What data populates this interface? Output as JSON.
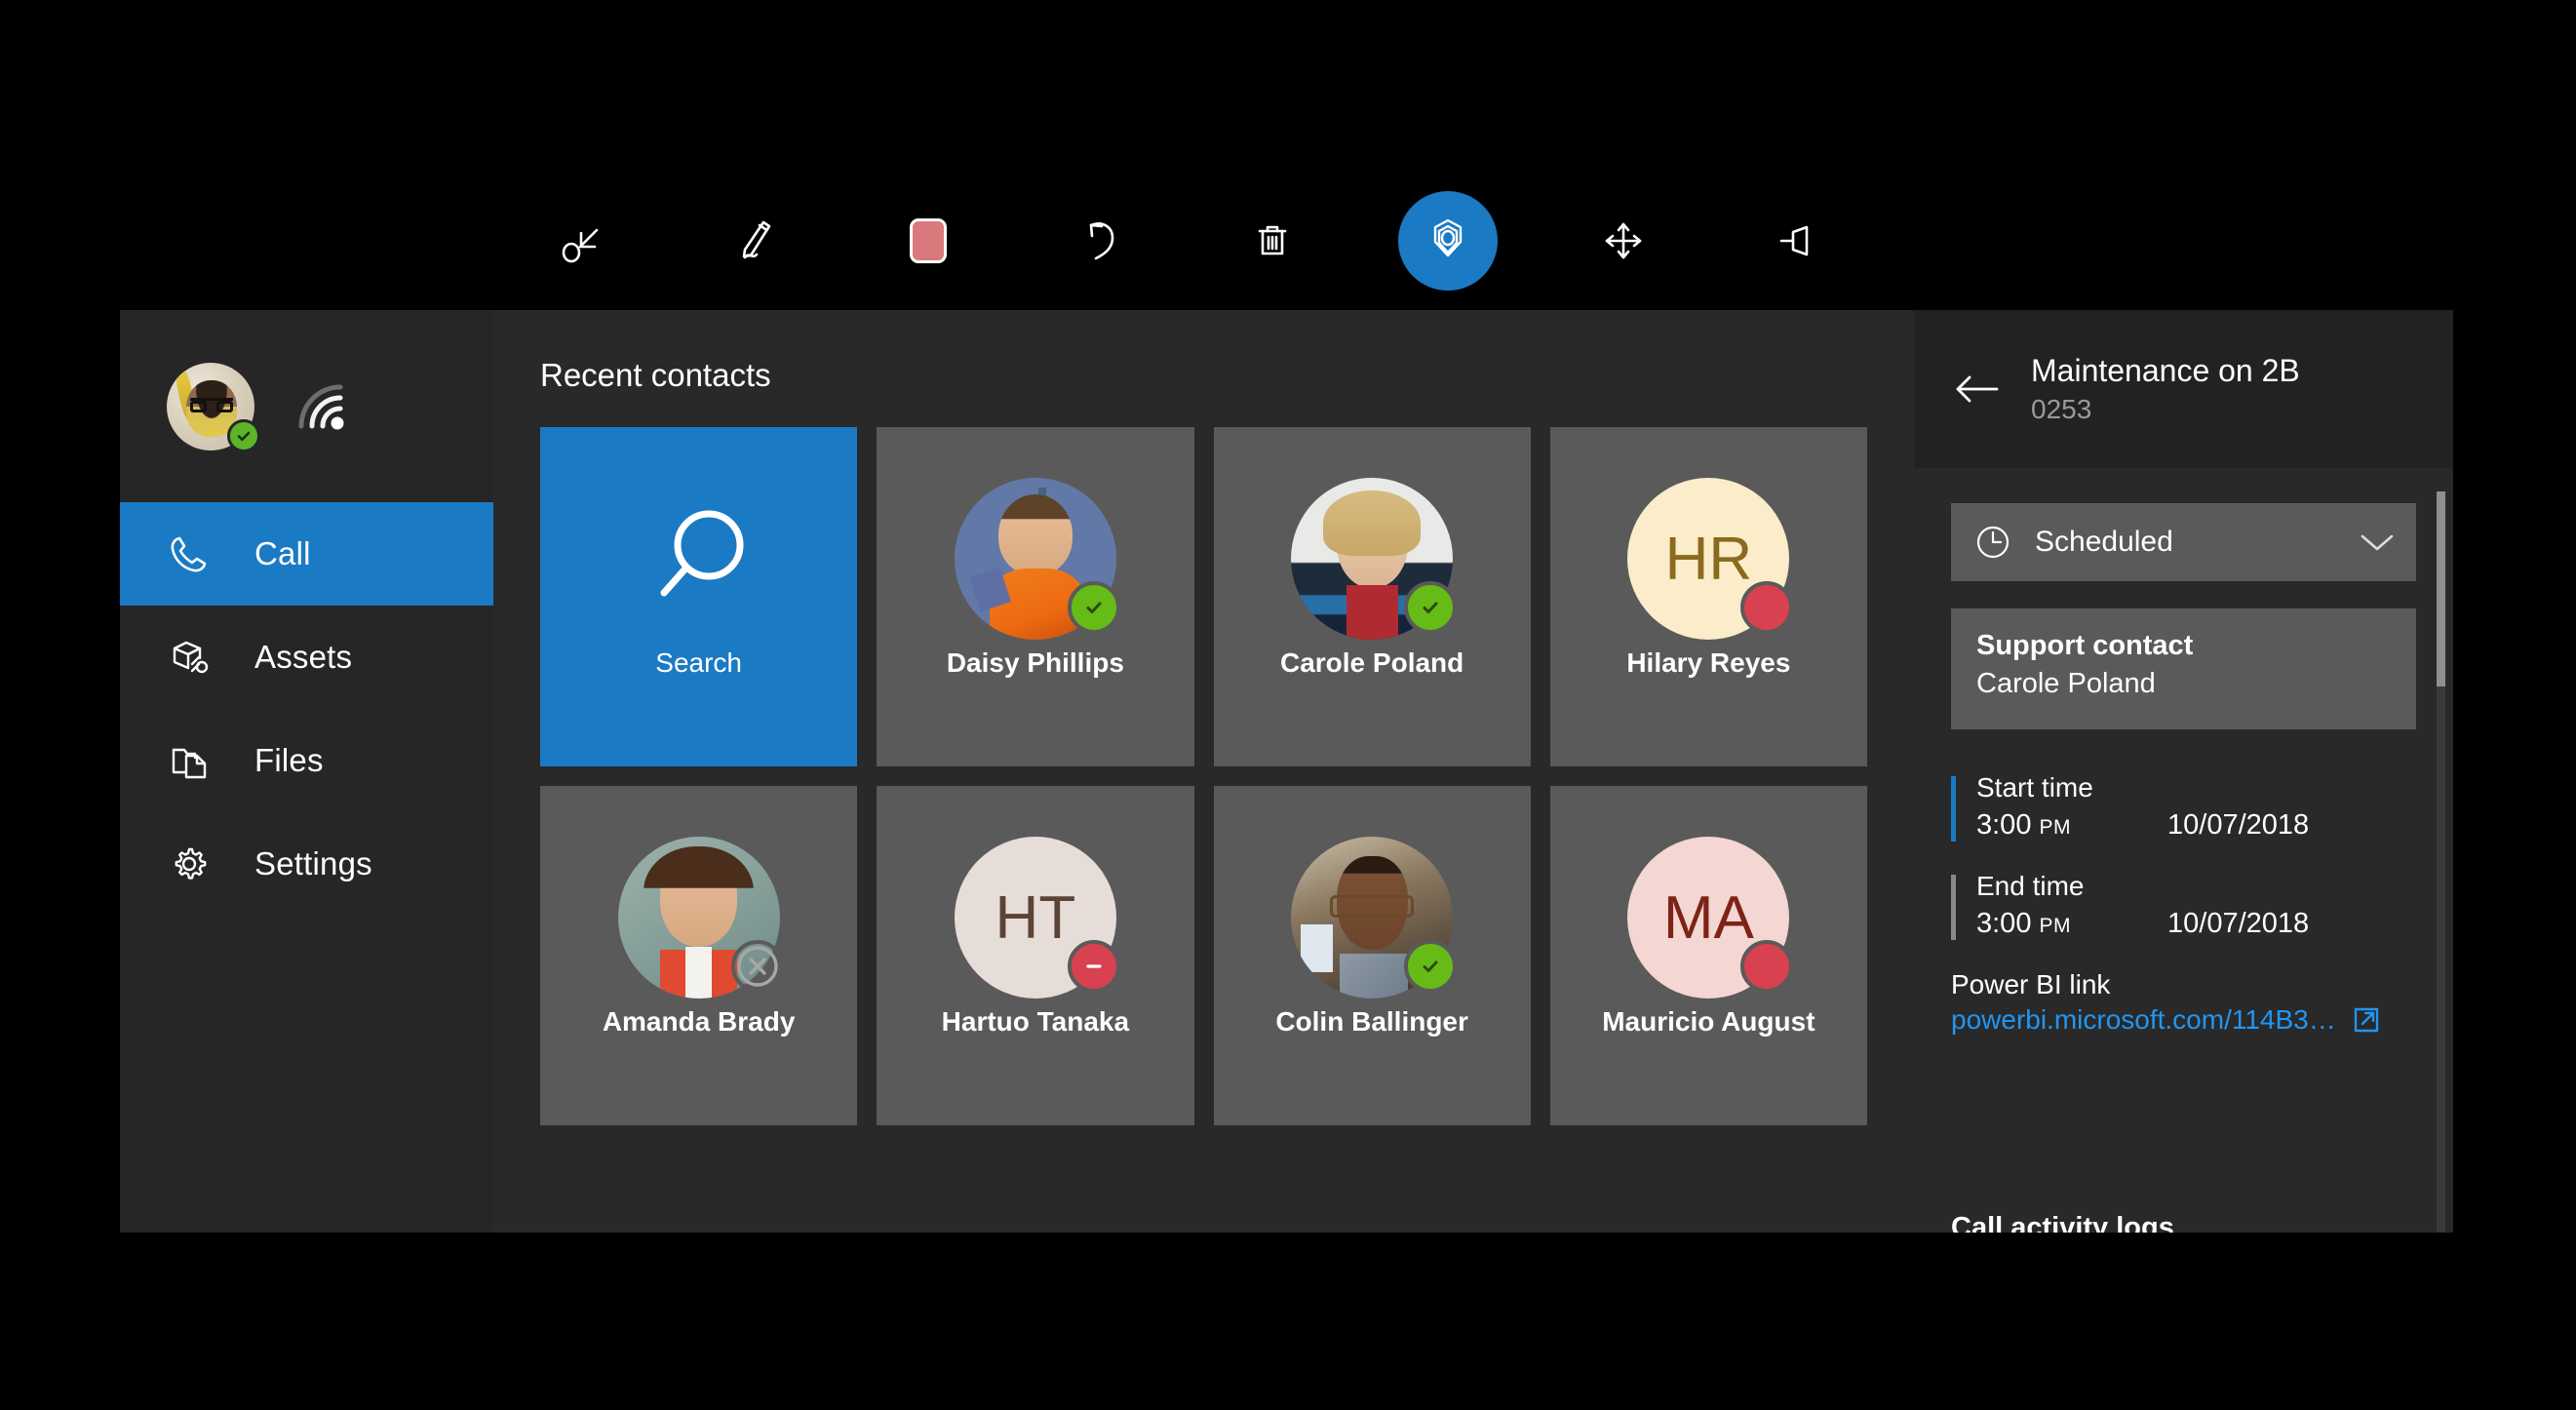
{
  "toolbar": {
    "items": [
      {
        "name": "select-lasso-icon",
        "label": "Select"
      },
      {
        "name": "pen-icon",
        "label": "Ink"
      },
      {
        "name": "color-swatch-icon",
        "label": "Color",
        "color": "#d9787d"
      },
      {
        "name": "undo-icon",
        "label": "Undo"
      },
      {
        "name": "delete-icon",
        "label": "Delete"
      },
      {
        "name": "place-hologram-icon",
        "label": "Place",
        "active": true,
        "accent": "#1b7ac4"
      },
      {
        "name": "move-icon",
        "label": "Move"
      },
      {
        "name": "pin-icon",
        "label": "Pin"
      }
    ]
  },
  "sidebar": {
    "profile": {
      "status": "online",
      "status_color": "#5db329",
      "network_icon": "wifi-icon"
    },
    "items": [
      {
        "label": "Call",
        "icon": "phone-icon",
        "selected": true
      },
      {
        "label": "Assets",
        "icon": "box-wrench-icon",
        "selected": false
      },
      {
        "label": "Files",
        "icon": "folder-file-icon",
        "selected": false
      }
    ],
    "footer_item": {
      "label": "Settings",
      "icon": "gear-icon"
    }
  },
  "main": {
    "title": "Recent contacts",
    "search_tile": {
      "label": "Search",
      "icon": "search-icon",
      "color": "#1b7ac4"
    },
    "contacts": [
      {
        "name": "Daisy Phillips",
        "type": "photo",
        "photo": "daisy",
        "status": "online"
      },
      {
        "name": "Carole Poland",
        "type": "photo",
        "photo": "carole",
        "status": "online"
      },
      {
        "name": "Hilary Reyes",
        "type": "initials",
        "initials": "HR",
        "bg": "#fbecca",
        "fg": "#8a6a1c",
        "status": "busy"
      },
      {
        "name": "Amanda Brady",
        "type": "photo",
        "photo": "amanda",
        "status": "offline"
      },
      {
        "name": "Hartuo Tanaka",
        "type": "initials",
        "initials": "HT",
        "bg": "#e7ddd8",
        "fg": "#5c4336",
        "status": "dnd"
      },
      {
        "name": "Colin Ballinger",
        "type": "photo",
        "photo": "colin",
        "status": "online"
      },
      {
        "name": "Mauricio August",
        "type": "initials",
        "initials": "MA",
        "bg": "#f4d6d2",
        "fg": "#7e2316",
        "status": "busy"
      }
    ]
  },
  "detail": {
    "back_icon": "back-arrow-icon",
    "title": "Maintenance on 2B",
    "subtitle": "0253",
    "status": {
      "label": "Scheduled",
      "icon": "clock-icon",
      "chevron": "chevron-down-icon"
    },
    "support_contact": {
      "label": "Support contact",
      "value": "Carole Poland"
    },
    "start_time": {
      "label": "Start time",
      "time": "3:00",
      "ampm": "PM",
      "date": "10/07/2018",
      "accent": "#1b7ac4"
    },
    "end_time": {
      "label": "End time",
      "time": "3:00",
      "ampm": "PM",
      "date": "10/07/2018",
      "accent": "#8a8a8a"
    },
    "power_bi": {
      "label": "Power BI link",
      "url": "powerbi.microsoft.com/114B3…",
      "icon": "external-link-icon",
      "color": "#2196f3"
    },
    "logs_title": "Call activity logs"
  }
}
